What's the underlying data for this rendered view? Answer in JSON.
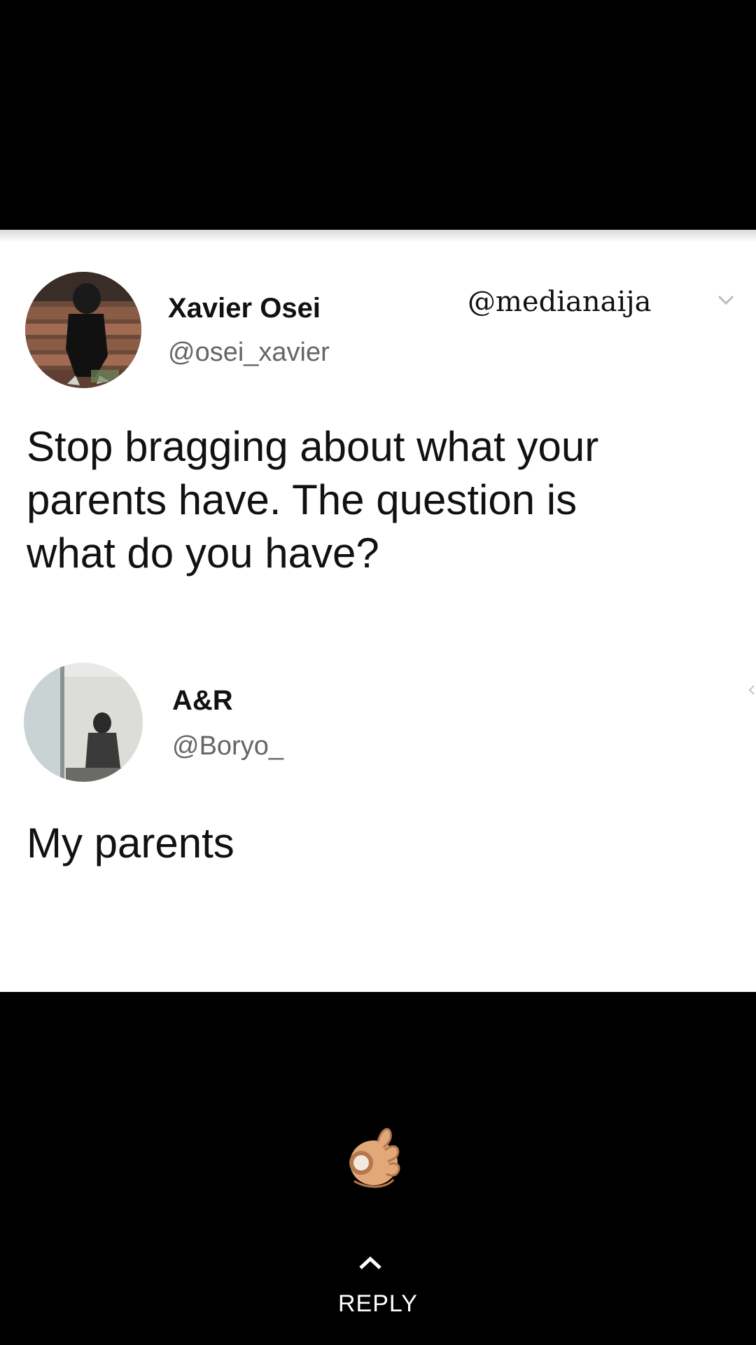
{
  "tweet": {
    "author_name": "Xavier Osei",
    "author_handle": "@osei_xavier",
    "watermark": "@medianaija",
    "text": "Stop bragging about what your\nparents have. The question is\nwhat do you  have?",
    "menu_icon": "chevron-down-icon"
  },
  "reply_tweet": {
    "author_name": "A&R",
    "author_handle": "@Boryo_",
    "text": "My parents"
  },
  "footer": {
    "emoji": "ok-hand",
    "caret_icon": "chevron-up-icon",
    "reply_label": "REPLY"
  }
}
